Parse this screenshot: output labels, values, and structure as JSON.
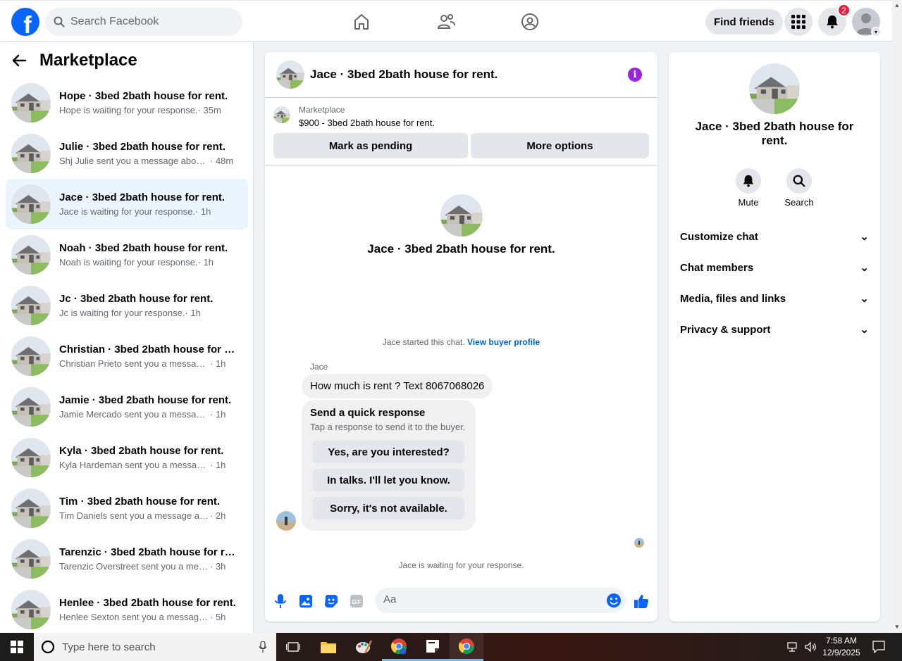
{
  "topbar": {
    "logo": "f",
    "search_placeholder": "Search Facebook",
    "find_friends": "Find friends",
    "notification_count": "2"
  },
  "sidebar": {
    "title": "Marketplace",
    "conversations": [
      {
        "title": "Hope · 3bed 2bath house for rent.",
        "preview": "Hope is waiting for your response.",
        "time": " · 35m"
      },
      {
        "title": "Julie · 3bed 2bath house for rent.",
        "preview": "Shj Julie sent you a message about ...",
        "time": " · 48m"
      },
      {
        "title": "Jace · 3bed 2bath house for rent.",
        "preview": "Jace is waiting for your response.",
        "time": " · 1h"
      },
      {
        "title": "Noah · 3bed 2bath house for rent.",
        "preview": "Noah is waiting for your response.",
        "time": " · 1h"
      },
      {
        "title": "Jc · 3bed 2bath house for rent.",
        "preview": "Jc is waiting for your response.",
        "time": " · 1h"
      },
      {
        "title": "Christian · 3bed 2bath house for re...",
        "preview": "Christian Prieto sent you a message a...",
        "time": " · 1h"
      },
      {
        "title": "Jamie · 3bed 2bath house for rent.",
        "preview": "Jamie Mercado sent you a message a...",
        "time": " · 1h"
      },
      {
        "title": "Kyla · 3bed 2bath house for rent.",
        "preview": "Kyla Hardeman sent you a message a...",
        "time": " · 1h"
      },
      {
        "title": "Tim · 3bed 2bath house for rent.",
        "preview": "Tim Daniels sent you a message abou...",
        "time": " · 2h"
      },
      {
        "title": "Tarenzic · 3bed 2bath house for re...",
        "preview": "Tarenzic Overstreet sent you a messag...",
        "time": " · 3h"
      },
      {
        "title": "Henlee · 3bed 2bath house for rent.",
        "preview": "Henlee Sexton sent you a message ab...",
        "time": " · 5h"
      }
    ]
  },
  "chat": {
    "title": "Jace · 3bed 2bath house for rent.",
    "listing_label": "Marketplace",
    "listing_price": "$900 - 3bed 2bath house for rent.",
    "mark_pending": "Mark as pending",
    "more_options": "More options",
    "intro_name": "Jace · 3bed 2bath house for rent.",
    "started_text": "Jace started this chat.",
    "buyer_profile_link": "View buyer profile",
    "sender_name": "Jace",
    "message": "How much is rent ? Text 8067068026",
    "quick_title": "Send a quick response",
    "quick_sub": "Tap a response to send it to the buyer.",
    "quick_responses": [
      "Yes, are you interested?",
      "In talks. I'll let you know.",
      "Sorry, it's not available."
    ],
    "waiting_text": "Jace is waiting for your response.",
    "composer_placeholder": "Aa",
    "info_icon": "i"
  },
  "info_panel": {
    "name": "Jace · 3bed 2bath house for rent.",
    "mute": "Mute",
    "search": "Search",
    "sections": [
      "Customize chat",
      "Chat members",
      "Media, files and links",
      "Privacy & support"
    ]
  },
  "taskbar": {
    "search_placeholder": "Type here to search",
    "time": "7:58 AM",
    "date": "12/9/2025"
  },
  "colors": {
    "accent": "#0866ff",
    "active_row": "#ebf5ff",
    "info": "#9b26d9",
    "badge": "#e41e3f"
  }
}
